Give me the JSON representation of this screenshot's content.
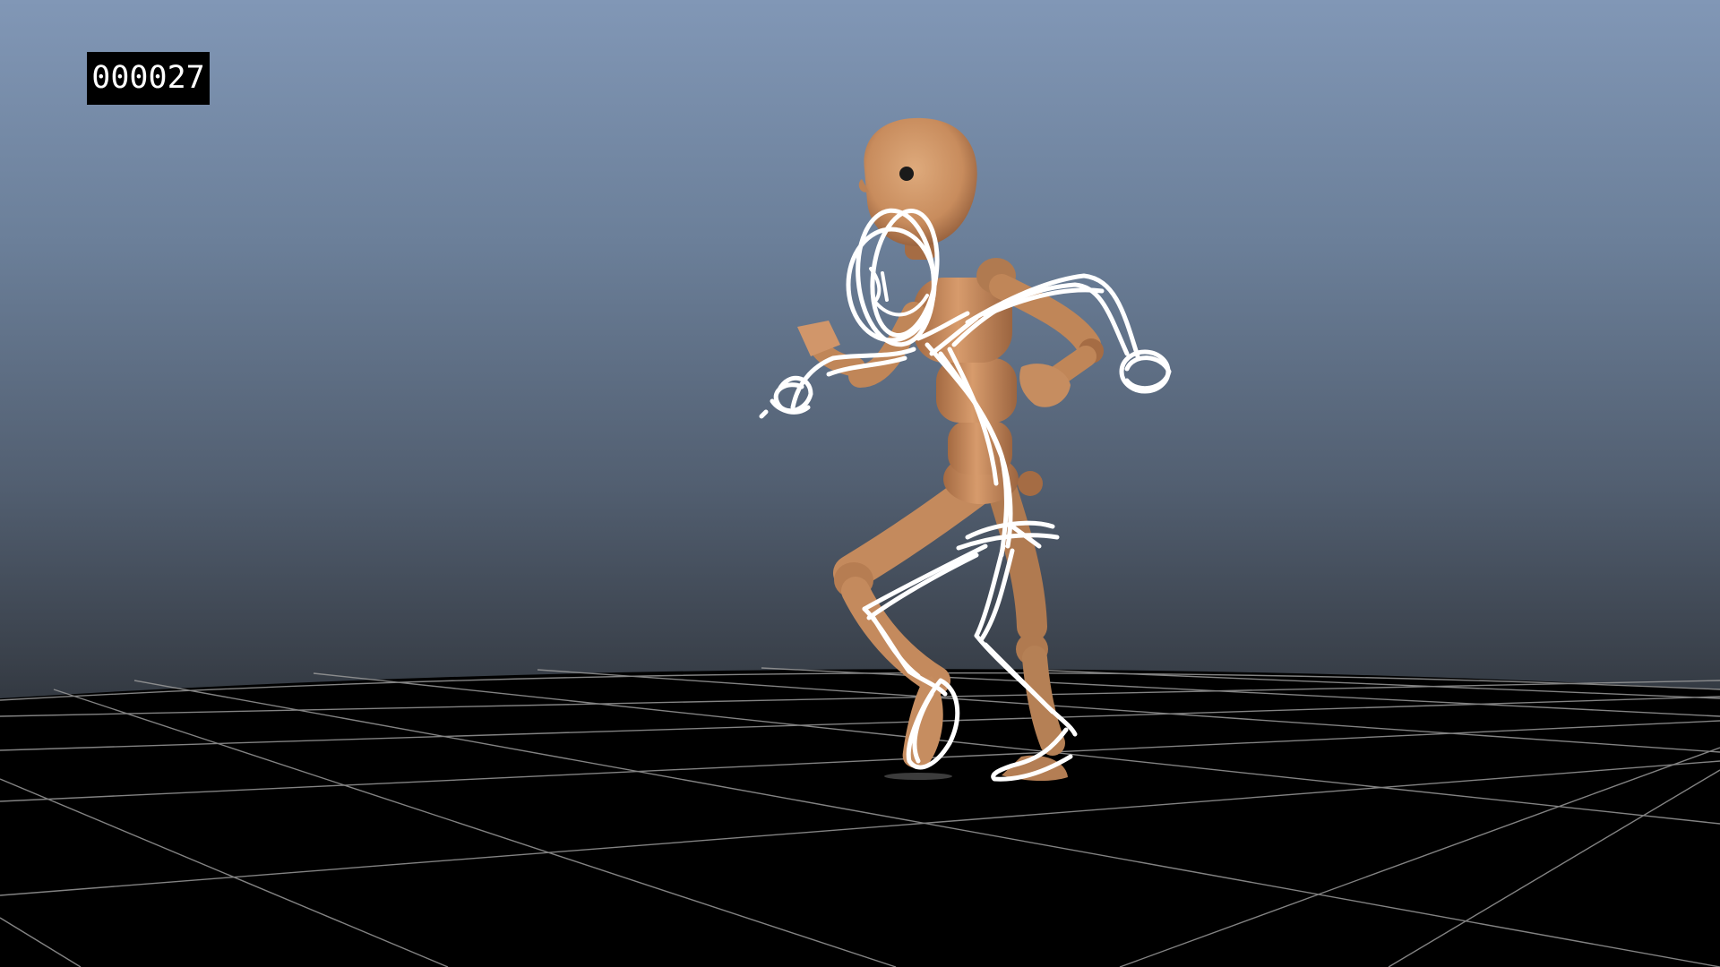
{
  "viewport": {
    "frame_counter": "000027"
  },
  "colors": {
    "sky_top": "#8197b6",
    "sky_bottom": "#2c3036",
    "ground": "#000000",
    "grid_lines": "#9a9a9a",
    "character_body": "#c98f62",
    "sketch_overlay": "#ffffff"
  },
  "icons": {
    "character": "wooden-mannequin-figure",
    "overlay": "hand-drawn-stick-figure-sketch"
  }
}
